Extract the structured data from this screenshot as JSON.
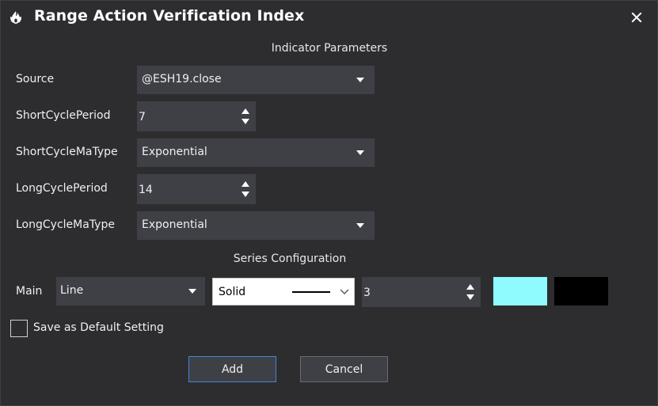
{
  "window": {
    "title": "Range Action Verification Index",
    "icon": "flame-icon",
    "close_icon": "close-icon"
  },
  "indicator_parameters": {
    "heading": "Indicator Parameters",
    "source": {
      "label": "Source",
      "value": "@ESH19.close"
    },
    "short_cycle_period": {
      "label": "ShortCyclePeriod",
      "value": "7"
    },
    "short_cycle_ma_type": {
      "label": "ShortCycleMaType",
      "value": "Exponential"
    },
    "long_cycle_period": {
      "label": "LongCyclePeriod",
      "value": "14"
    },
    "long_cycle_ma_type": {
      "label": "LongCycleMaType",
      "value": "Exponential"
    }
  },
  "series_configuration": {
    "heading": "Series Configuration",
    "main": {
      "label": "Main",
      "plot_type": "Line",
      "line_style": "Solid",
      "line_width": "3",
      "color": "#8ffbff",
      "secondary_color": "#000000"
    }
  },
  "save_default": {
    "label": "Save as Default Setting",
    "checked": false
  },
  "buttons": {
    "add": "Add",
    "cancel": "Cancel"
  },
  "colors": {
    "background": "#2d2d30",
    "control": "#3f3f46",
    "accent_border": "#3e88d8",
    "text": "#f0f0f0"
  }
}
